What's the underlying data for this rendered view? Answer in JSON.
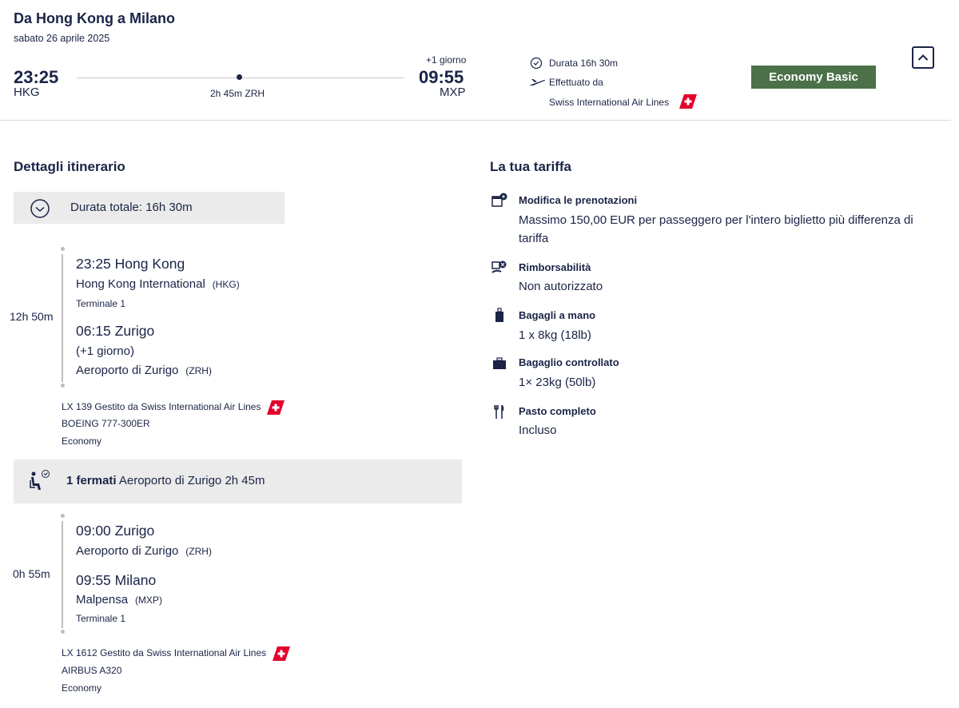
{
  "header": {
    "title": "Da Hong Kong a Milano",
    "date": "sabato 26 aprile 2025",
    "departure": {
      "time": "23:25",
      "code": "HKG"
    },
    "arrival": {
      "day_offset": "+1 giorno",
      "time": "09:55",
      "code": "MXP"
    },
    "stopover": {
      "duration": "2h 45m",
      "code": "ZRH"
    },
    "duration_label": "Durata 16h 30m",
    "operated_label": "Effettuato da",
    "airline": "Swiss International Air Lines",
    "fare_badge": "Economy Basic"
  },
  "itinerary": {
    "title": "Dettagli itinerario",
    "total_duration": "Durata totale: 16h 30m",
    "segments": [
      {
        "duration": "12h 50m",
        "dep_time_city": "23:25 Hong Kong",
        "dep_airport": "Hong Kong International",
        "dep_code": "(HKG)",
        "dep_terminal": "Terminale 1",
        "arr_time_city": "06:15 Zurigo",
        "arr_offset": "(+1 giorno)",
        "arr_airport": "Aeroporto di Zurigo",
        "arr_code": "(ZRH)",
        "flight_line": "LX 139  Gestito da Swiss International Air Lines",
        "aircraft": "BOEING 777-300ER",
        "cabin": "Economy"
      },
      {
        "duration": "0h 55m",
        "dep_time_city": "09:00 Zurigo",
        "dep_airport": "Aeroporto di Zurigo",
        "dep_code": "(ZRH)",
        "arr_time_city": "09:55 Milano",
        "arr_airport": "Malpensa",
        "arr_code": "(MXP)",
        "arr_terminal": "Terminale 1",
        "flight_line": "LX 1612  Gestito da Swiss International Air Lines",
        "aircraft": "AIRBUS A320",
        "cabin": "Economy"
      }
    ],
    "stop": {
      "count": "1 fermati",
      "detail": "Aeroporto di Zurigo 2h 45m"
    }
  },
  "fare": {
    "title": "La tua tariffa",
    "items": [
      {
        "icon": "calendar-change-icon",
        "label": "Modifica le prenotazioni",
        "value": "Massimo 150,00 EUR per passeggero per l'intero biglietto più differenza di tariffa"
      },
      {
        "icon": "refund-icon",
        "label": "Rimborsabilità",
        "value": "Non autorizzato"
      },
      {
        "icon": "hand-baggage-icon",
        "label": "Bagagli a mano",
        "value": "1 x 8kg (18lb)"
      },
      {
        "icon": "checked-baggage-icon",
        "label": "Bagaglio controllato",
        "value": "1× 23kg (50lb)"
      },
      {
        "icon": "cutlery-icon",
        "label": "Pasto completo",
        "value": "Incluso"
      }
    ]
  },
  "colors": {
    "navy": "#1b2447",
    "badge_green": "#4c7149",
    "swiss_red": "#e4002b",
    "grey_bar": "#ebebeb"
  }
}
